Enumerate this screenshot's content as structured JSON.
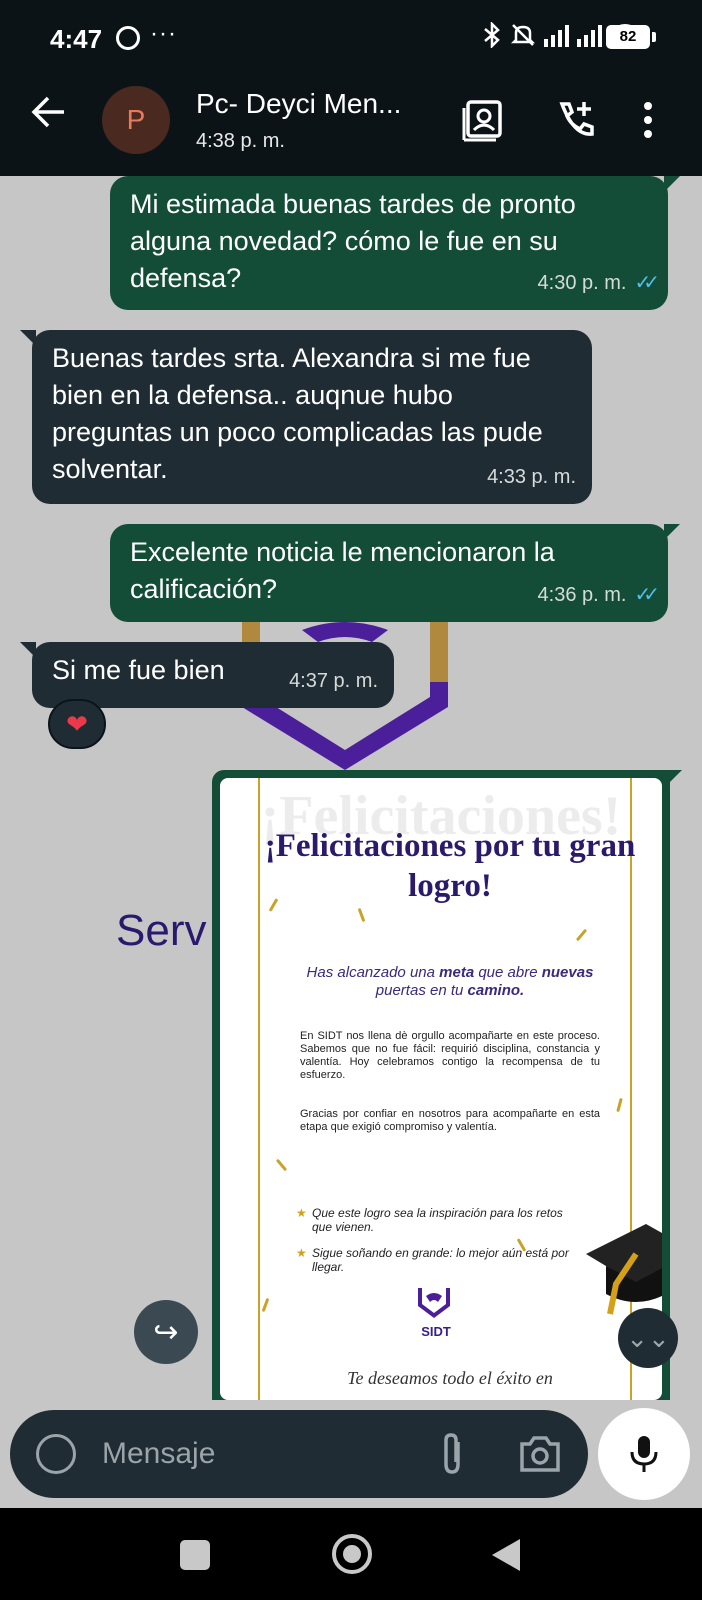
{
  "status_bar": {
    "time": "4:47",
    "more": "···",
    "battery": "82"
  },
  "header": {
    "avatar_letter": "P",
    "name": "Pc- Deyci Men...",
    "status": "4:38 p. m."
  },
  "messages": [
    {
      "text": "Mi estimada buenas tardes de pronto alguna novedad? cómo le fue en su defensa?",
      "time": "4:30 p. m.",
      "ticks": "✓✓"
    },
    {
      "text": "Buenas tardes srta. Alexandra si me fue bien en la defensa.. auqnue hubo preguntas un poco complicadas las pude solventar.",
      "time": "4:33 p. m."
    },
    {
      "text": "Excelente noticia le mencionaron la calificación?",
      "time": "4:36 p. m.",
      "ticks": "✓✓"
    },
    {
      "text": "Si me fue bien",
      "time": "4:37 p. m.",
      "reaction": "❤"
    }
  ],
  "wallpaper": {
    "text": "Serv"
  },
  "poster": {
    "bg_text": "¡Felicitaciones!",
    "title": "¡Felicitaciones por tu gran logro!",
    "subtitle_1": "Has alcanzado una ",
    "subtitle_bold_1": "meta",
    "subtitle_2": " que abre ",
    "subtitle_bold_2": "nuevas",
    "subtitle_3": " puertas en tu ",
    "subtitle_bold_3": "camino.",
    "para_1": "En SIDT nos llena dè orgullo acompañarte en este proceso. Sabemos que no fue fácil: requirió disciplina, constancia y valentía. Hoy celebramos contigo la recompensa de tu esfuerzo.",
    "para_2": "Gracias por confiar en nosotros para acompañarte en esta etapa que exigió compromiso y valentía.",
    "bullet_1": "Que este logro sea la inspiración para los retos que vienen.",
    "bullet_2": "Sigue soñando en grande: lo mejor aún está por llegar.",
    "logo_text": "SIDT",
    "footer": "Te deseamos todo el éxito en"
  },
  "composer": {
    "placeholder": "Mensaje"
  },
  "icons": {
    "forward": "↪",
    "scroll_down": "⌄⌄"
  },
  "colors": {
    "outgoing": "#134d37",
    "incoming": "#1f2c33",
    "header": "#0c1317",
    "wallpaper": "#c6c6c6"
  }
}
